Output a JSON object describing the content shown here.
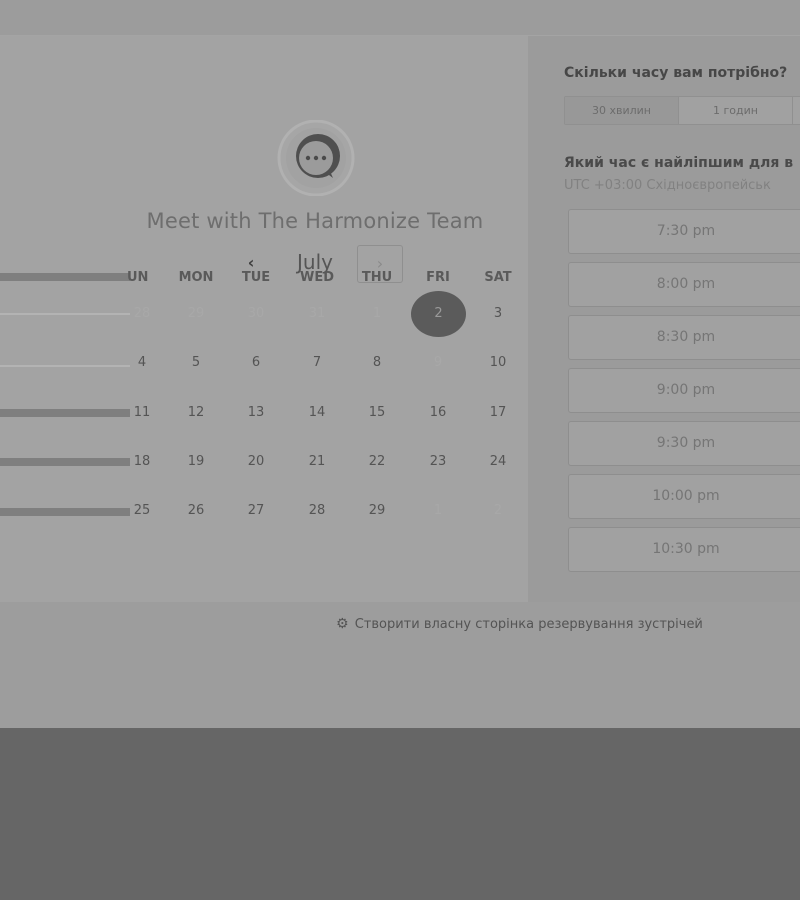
{
  "event": {
    "host_title": "Meet with The Harmonize Team",
    "logo_icon": "chat-bubble-ellipsis-icon"
  },
  "calendar": {
    "month": "July",
    "prev_icon": "chevron-left-icon",
    "next_icon": "chevron-right-icon",
    "prev_symbol": "‹",
    "next_symbol": "›",
    "weekdays": [
      "UN",
      "MON",
      "TUE",
      "WED",
      "THU",
      "FRI",
      "SAT"
    ],
    "weeks": [
      [
        "28",
        "29",
        "30",
        "31",
        "1",
        "2",
        "3"
      ],
      [
        "4",
        "5",
        "6",
        "7",
        "8",
        "9",
        "10"
      ],
      [
        "11",
        "12",
        "13",
        "14",
        "15",
        "16",
        "17"
      ],
      [
        "18",
        "19",
        "20",
        "21",
        "22",
        "23",
        "24"
      ],
      [
        "25",
        "26",
        "27",
        "28",
        "29",
        "1",
        "2"
      ]
    ],
    "selected_day": "2"
  },
  "booking": {
    "duration_heading": "Скільки часу вам потрібно?",
    "durations": [
      "30 хвилин",
      "1 годин"
    ],
    "selected_duration": "30 хвилин",
    "time_heading": "Який час є найліпшим для в",
    "timezone": "UTC +03:00 Східноєвропейськ",
    "slots": [
      "7:30 pm",
      "8:00 pm",
      "8:30 pm",
      "9:00 pm",
      "9:30 pm",
      "10:00 pm",
      "10:30 pm"
    ]
  },
  "footer": {
    "create_link": "Створити власну сторінка резервування зустрічей",
    "brand_icon": "hubspot-sprocket-icon"
  },
  "colors": {
    "overlay": "#9a9a9a",
    "selected_day": "#5b5b5b",
    "dimmed_background": "#666666"
  }
}
